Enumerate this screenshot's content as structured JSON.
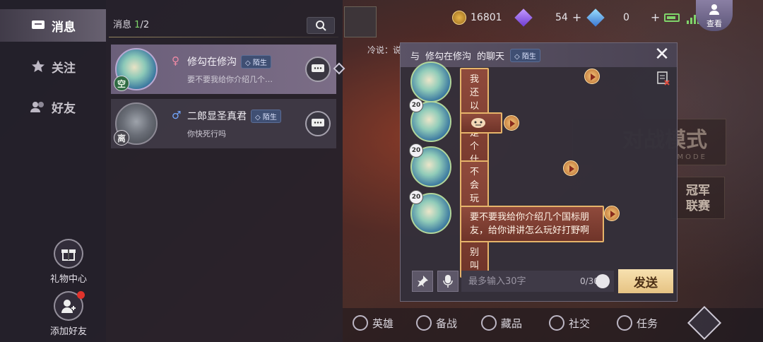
{
  "left_nav": {
    "items": [
      {
        "label": "消息",
        "icon": "chat-bubble-icon",
        "active": true
      },
      {
        "label": "关注",
        "icon": "star-icon",
        "active": false
      },
      {
        "label": "好友",
        "icon": "friends-icon",
        "active": false
      }
    ],
    "gift_center": {
      "label": "礼物中心",
      "icon": "gift-icon"
    },
    "add_friend": {
      "label": "添加好友",
      "icon": "add-friend-icon"
    }
  },
  "message_list": {
    "header_label": "消息",
    "page_current": "1",
    "page_total": "/2",
    "chats": [
      {
        "name": "修勾在修沟",
        "gender": "♀",
        "stranger_tag": "陌生",
        "status": "空",
        "preview": "要不要我给你介绍几个…",
        "selected": true
      },
      {
        "name": "二郎显圣真君",
        "gender": "♂",
        "stranger_tag": "陌生",
        "status": "离",
        "preview": "你快死行吗",
        "selected": false
      }
    ]
  },
  "top_bar": {
    "gold": "16801",
    "diamonds": "54",
    "crystals": "0",
    "view_button": "查看"
  },
  "cold_label": "冷说：说",
  "chat_window": {
    "title_prefix": "与",
    "partner": "修勾在修沟",
    "title_suffix": "的聊天",
    "stranger_tag": "陌生",
    "messages": [
      {
        "level": "20",
        "text": "我还以为是个什么东西"
      },
      {
        "level": "20",
        "text": "",
        "emote": true
      },
      {
        "level": "20",
        "text": "不会玩打野就别叫"
      },
      {
        "level": "20",
        "text": "要不要我给你介绍几个国标朋友，给你讲讲怎么玩好打野啊"
      }
    ],
    "input_placeholder": "最多输入30字",
    "input_value": "",
    "counter": "0/30",
    "send_label": "发送"
  },
  "background": {
    "mode_title": "对战模式",
    "mode_sub": "MODE",
    "champ_label_1": "冠军",
    "champ_label_2": "联赛"
  },
  "bottom_nav": [
    {
      "label": "英雄"
    },
    {
      "label": "备战"
    },
    {
      "label": "藏品"
    },
    {
      "label": "社交"
    },
    {
      "label": "任务"
    }
  ]
}
